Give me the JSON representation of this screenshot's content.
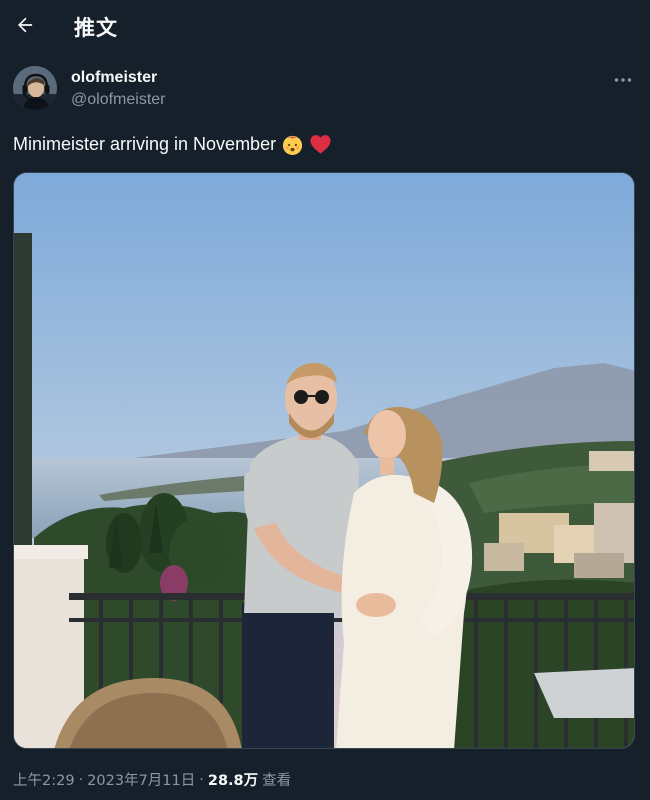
{
  "header": {
    "title": "推文",
    "back_icon": "arrow-left-icon"
  },
  "author": {
    "display_name": "olofmeister",
    "handle": "@olofmeister",
    "avatar_icon": "avatar-headset-icon",
    "more_icon": "more-dots-icon"
  },
  "tweet": {
    "text": "Minimeister arriving in November",
    "emojis": [
      "baby-face-icon",
      "red-heart-icon"
    ],
    "media_alt_icon": "photo-couple-balcony-icon"
  },
  "meta": {
    "time": "上午2:29",
    "separator": "·",
    "date": "2023年7月11日",
    "views_count": "28.8万",
    "views_label": "查看"
  },
  "colors": {
    "background": "#15202b",
    "text_primary": "#f7f9f9",
    "text_secondary": "#8b98a5",
    "border": "#38444d",
    "heart": "#f91880"
  }
}
